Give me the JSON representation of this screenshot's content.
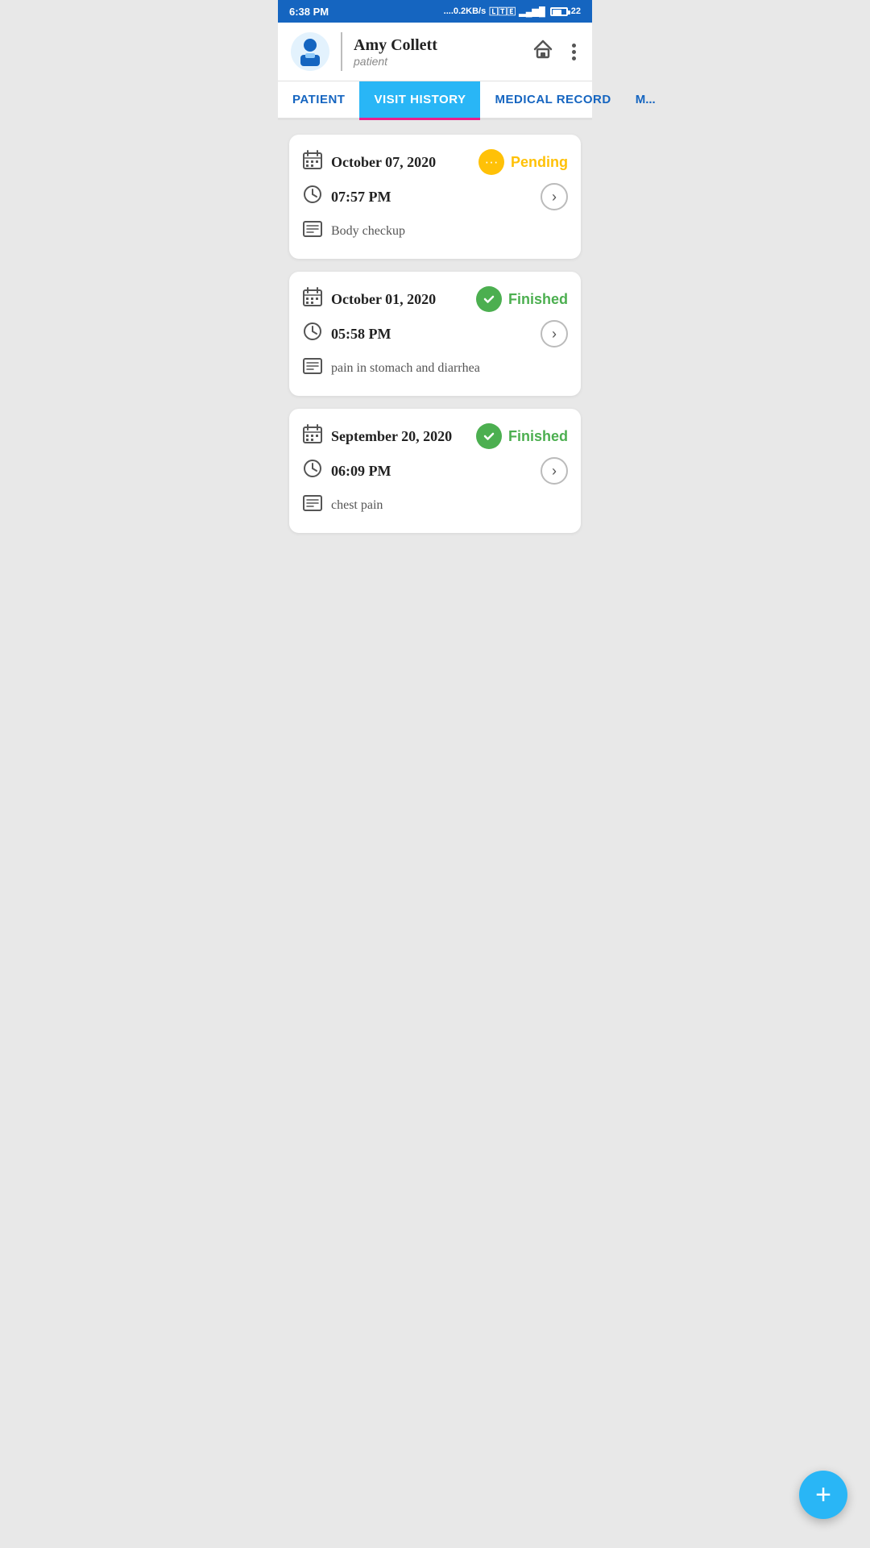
{
  "status_bar": {
    "time": "6:38 PM",
    "network": "....0.2KB/s",
    "battery": "22"
  },
  "header": {
    "patient_name": "Amy Collett",
    "patient_role": "patient"
  },
  "tabs": [
    {
      "id": "patient",
      "label": "PATIENT",
      "active": false
    },
    {
      "id": "visit_history",
      "label": "VISIT HISTORY",
      "active": true
    },
    {
      "id": "medical_record",
      "label": "MEDICAL RECORD",
      "active": false
    },
    {
      "id": "more",
      "label": "M...",
      "active": false
    }
  ],
  "visits": [
    {
      "date": "October 07, 2020",
      "time": "07:57 PM",
      "status_type": "pending",
      "status_label": "Pending",
      "description": "Body checkup"
    },
    {
      "date": "October 01, 2020",
      "time": "05:58 PM",
      "status_type": "finished",
      "status_label": "Finished",
      "description": "pain in stomach and diarrhea"
    },
    {
      "date": "September 20, 2020",
      "time": "06:09 PM",
      "status_type": "finished",
      "status_label": "Finished",
      "description": "chest pain"
    }
  ],
  "fab_label": "+"
}
